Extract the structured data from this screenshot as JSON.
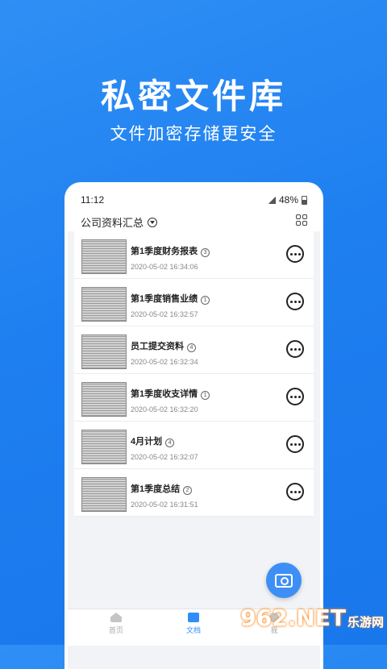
{
  "hero": {
    "title": "私密文件库",
    "subtitle": "文件加密存储更安全"
  },
  "status_bar": {
    "time": "11:12",
    "battery": "48%"
  },
  "folder": {
    "title": "公司资料汇总"
  },
  "documents": [
    {
      "name": "第1季度财务报表",
      "count": "3",
      "date": "2020-05-02 16:34:06"
    },
    {
      "name": "第1季度销售业绩",
      "count": "1",
      "date": "2020-05-02 16:32:57"
    },
    {
      "name": "员工提交资料",
      "count": "4",
      "date": "2020-05-02 16:32:34"
    },
    {
      "name": "第1季度收支详情",
      "count": "1",
      "date": "2020-05-02 16:32:20"
    },
    {
      "name": "4月计划",
      "count": "4",
      "date": "2020-05-02 16:32:07"
    },
    {
      "name": "第1季度总结",
      "count": "2",
      "date": "2020-05-02 16:31:51"
    }
  ],
  "tabs": [
    {
      "label": "首页",
      "icon": "home-icon"
    },
    {
      "label": "文档",
      "icon": "document-icon"
    },
    {
      "label": "我",
      "icon": "profile-icon"
    }
  ],
  "watermark": {
    "logo": "962.NET",
    "sub": "乐游网"
  },
  "colors": {
    "background": "#1e7ff0",
    "accent": "#2f8ff5"
  }
}
